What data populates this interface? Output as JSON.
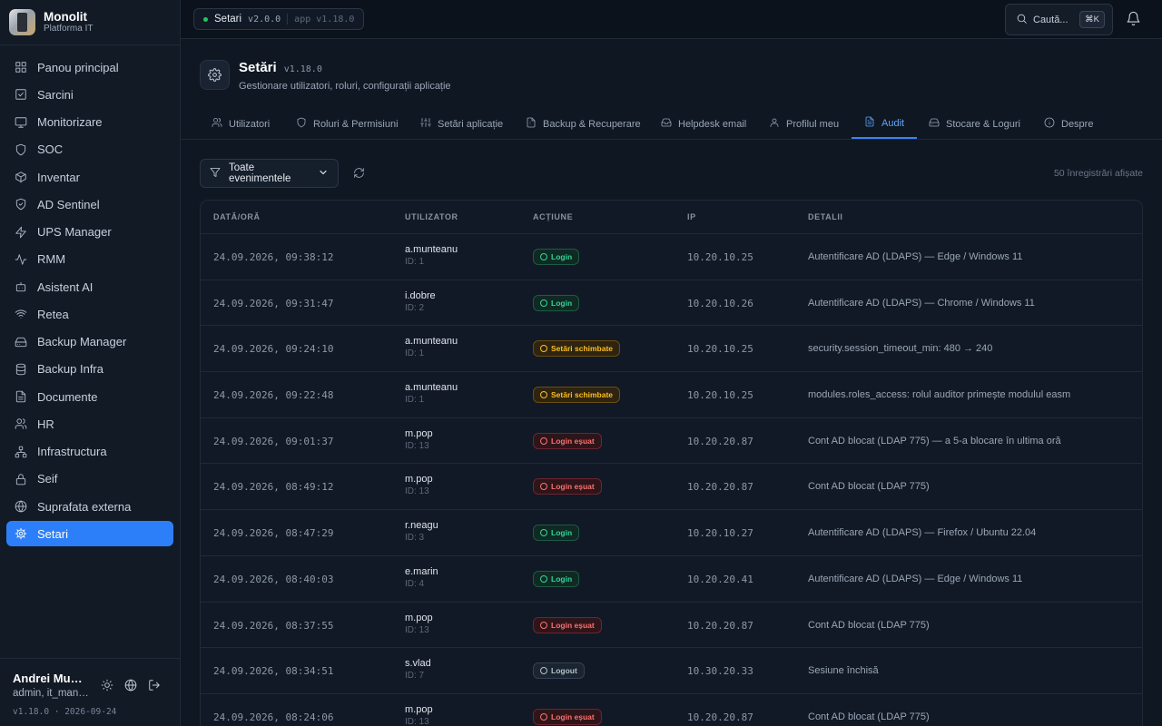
{
  "brand": {
    "name": "Monolit",
    "subtitle": "Platforma IT"
  },
  "sidebar": {
    "items": [
      {
        "label": "Panou principal",
        "icon": "grid-icon"
      },
      {
        "label": "Sarcini",
        "icon": "checkbox-icon"
      },
      {
        "label": "Monitorizare",
        "icon": "monitor-icon"
      },
      {
        "label": "SOC",
        "icon": "shield-icon"
      },
      {
        "label": "Inventar",
        "icon": "box-icon"
      },
      {
        "label": "AD Sentinel",
        "icon": "shield-check-icon"
      },
      {
        "label": "UPS Manager",
        "icon": "bolt-icon"
      },
      {
        "label": "RMM",
        "icon": "activity-icon"
      },
      {
        "label": "Asistent AI",
        "icon": "bot-icon"
      },
      {
        "label": "Retea",
        "icon": "wifi-icon"
      },
      {
        "label": "Backup Manager",
        "icon": "hard-drive-icon"
      },
      {
        "label": "Backup Infra",
        "icon": "database-icon"
      },
      {
        "label": "Documente",
        "icon": "file-icon"
      },
      {
        "label": "HR",
        "icon": "users-icon"
      },
      {
        "label": "Infrastructura",
        "icon": "network-icon"
      },
      {
        "label": "Seif",
        "icon": "lock-icon"
      },
      {
        "label": "Suprafata externa",
        "icon": "globe-icon"
      },
      {
        "label": "Setari",
        "icon": "gear-icon",
        "active": true
      }
    ],
    "user": {
      "name": "Andrei Munteanu",
      "role": "admin, it_manager"
    },
    "version_line": "v1.18.0 · 2026-09-24"
  },
  "topbar": {
    "app_name": "Setari",
    "app_version": "v2.0.0",
    "app_label": "app v1.18.0",
    "search_placeholder": "Caută...",
    "shortcut": "⌘K"
  },
  "header": {
    "title": "Setări",
    "version": "v1.18.0",
    "subtitle": "Gestionare utilizatori, roluri, configurații aplicație"
  },
  "tabs": [
    {
      "label": "Utilizatori",
      "icon": "users-icon"
    },
    {
      "label": "Roluri & Permisiuni",
      "icon": "shield-icon"
    },
    {
      "label": "Setări aplicație",
      "icon": "sliders-icon"
    },
    {
      "label": "Backup & Recuperare",
      "icon": "file-archive-icon"
    },
    {
      "label": "Helpdesk email",
      "icon": "inbox-icon"
    },
    {
      "label": "Profilul meu",
      "icon": "user-icon"
    },
    {
      "label": "Audit",
      "icon": "file-text-icon",
      "active": true
    },
    {
      "label": "Stocare & Loguri",
      "icon": "hard-drive-icon"
    },
    {
      "label": "Despre",
      "icon": "info-icon"
    }
  ],
  "filter": {
    "label": "Toate evenimentele",
    "count_text": "50 înregistrări afișate"
  },
  "table": {
    "columns": [
      "DATĂ/ORĂ",
      "UTILIZATOR",
      "ACȚIUNE",
      "IP",
      "DETALII"
    ],
    "rows": [
      {
        "date": "24.09.2026, 09:38:12",
        "user": "a.munteanu",
        "uid": "ID: 1",
        "action": "Login",
        "kind": "login",
        "ip": "10.20.10.25",
        "details": "Autentificare AD (LDAPS) — Edge / Windows 11"
      },
      {
        "date": "24.09.2026, 09:31:47",
        "user": "i.dobre",
        "uid": "ID: 2",
        "action": "Login",
        "kind": "login",
        "ip": "10.20.10.26",
        "details": "Autentificare AD (LDAPS) — Chrome / Windows 11"
      },
      {
        "date": "24.09.2026, 09:24:10",
        "user": "a.munteanu",
        "uid": "ID: 1",
        "action": "Setări schimbate",
        "kind": "setari",
        "ip": "10.20.10.25",
        "details": "security.session_timeout_min: 480 → 240"
      },
      {
        "date": "24.09.2026, 09:22:48",
        "user": "a.munteanu",
        "uid": "ID: 1",
        "action": "Setări schimbate",
        "kind": "setari",
        "ip": "10.20.10.25",
        "details": "modules.roles_access: rolul auditor primește modulul easm"
      },
      {
        "date": "24.09.2026, 09:01:37",
        "user": "m.pop",
        "uid": "ID: 13",
        "action": "Login eșuat",
        "kind": "fail",
        "ip": "10.20.20.87",
        "details": "Cont AD blocat (LDAP 775) — a 5-a blocare în ultima oră"
      },
      {
        "date": "24.09.2026, 08:49:12",
        "user": "m.pop",
        "uid": "ID: 13",
        "action": "Login eșuat",
        "kind": "fail",
        "ip": "10.20.20.87",
        "details": "Cont AD blocat (LDAP 775)"
      },
      {
        "date": "24.09.2026, 08:47:29",
        "user": "r.neagu",
        "uid": "ID: 3",
        "action": "Login",
        "kind": "login",
        "ip": "10.20.10.27",
        "details": "Autentificare AD (LDAPS) — Firefox / Ubuntu 22.04"
      },
      {
        "date": "24.09.2026, 08:40:03",
        "user": "e.marin",
        "uid": "ID: 4",
        "action": "Login",
        "kind": "login",
        "ip": "10.20.20.41",
        "details": "Autentificare AD (LDAPS) — Edge / Windows 11"
      },
      {
        "date": "24.09.2026, 08:37:55",
        "user": "m.pop",
        "uid": "ID: 13",
        "action": "Login eșuat",
        "kind": "fail",
        "ip": "10.20.20.87",
        "details": "Cont AD blocat (LDAP 775)"
      },
      {
        "date": "24.09.2026, 08:34:51",
        "user": "s.vlad",
        "uid": "ID: 7",
        "action": "Logout",
        "kind": "logout",
        "ip": "10.30.20.33",
        "details": "Sesiune închisă"
      },
      {
        "date": "24.09.2026, 08:24:06",
        "user": "m.pop",
        "uid": "ID: 13",
        "action": "Login eșuat",
        "kind": "fail",
        "ip": "10.20.20.87",
        "details": "Cont AD blocat (LDAP 775)"
      }
    ]
  }
}
